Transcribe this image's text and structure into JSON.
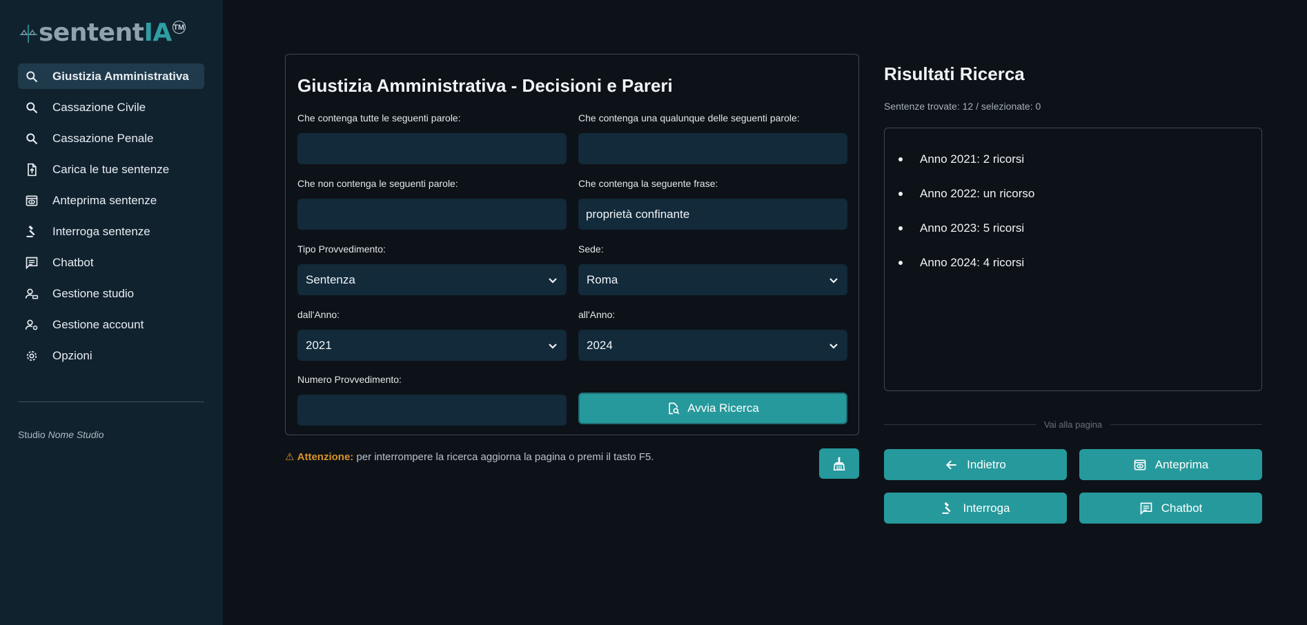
{
  "logo": {
    "text_a": "sentent",
    "text_b": "IA",
    "tm": "TM"
  },
  "sidebar": {
    "items": [
      {
        "label": "Giustizia Amministrativa",
        "icon": "search-icon"
      },
      {
        "label": "Cassazione Civile",
        "icon": "search-icon"
      },
      {
        "label": "Cassazione Penale",
        "icon": "search-icon"
      },
      {
        "label": "Carica le tue sentenze",
        "icon": "file-upload-icon"
      },
      {
        "label": "Anteprima sentenze",
        "icon": "preview-icon"
      },
      {
        "label": "Interroga sentenze",
        "icon": "gavel-icon"
      },
      {
        "label": "Chatbot",
        "icon": "chat-icon"
      },
      {
        "label": "Gestione studio",
        "icon": "manage-accounts-icon"
      },
      {
        "label": "Gestione account",
        "icon": "manage-account-icon"
      },
      {
        "label": "Opzioni",
        "icon": "gear-icon"
      }
    ],
    "studio_prefix": "Studio",
    "studio_name": "Nome Studio"
  },
  "form": {
    "title": "Giustizia Amministrativa - Decisioni e Pareri",
    "all_words": {
      "label": "Che contenga tutte le seguenti parole:",
      "value": ""
    },
    "any_words": {
      "label": "Che contenga una qualunque delle seguenti parole:",
      "value": ""
    },
    "not_words": {
      "label": "Che non contenga le seguenti parole:",
      "value": ""
    },
    "phrase": {
      "label": "Che contenga la seguente frase:",
      "value": "proprietà confinante"
    },
    "tipo": {
      "label": "Tipo Provvedimento:",
      "value": "Sentenza"
    },
    "sede": {
      "label": "Sede:",
      "value": "Roma"
    },
    "from_year": {
      "label": "dall'Anno:",
      "value": "2021"
    },
    "to_year": {
      "label": "all'Anno:",
      "value": "2024"
    },
    "numero": {
      "label": "Numero Provvedimento:",
      "value": ""
    },
    "search_button": "Avvia Ricerca"
  },
  "warning": {
    "icon": "⚠",
    "strong": "Attenzione:",
    "text": "per interrompere la ricerca aggiorna la pagina o premi il tasto F5."
  },
  "results": {
    "title": "Risultati Ricerca",
    "count": "Sentenze trovate: 12 / selezionate: 0",
    "items": [
      "Anno 2021: 2 ricorsi",
      "Anno 2022: un ricorso",
      "Anno 2023: 5 ricorsi",
      "Anno 2024: 4 ricorsi"
    ],
    "goto_label": "Vai alla pagina",
    "buttons": {
      "back": "Indietro",
      "preview": "Anteprima",
      "query": "Interroga",
      "chatbot": "Chatbot"
    }
  },
  "colors": {
    "accent": "#26999c",
    "sidebar_bg": "#11222f",
    "page_bg": "#0d1218",
    "warning": "#d8932b"
  }
}
